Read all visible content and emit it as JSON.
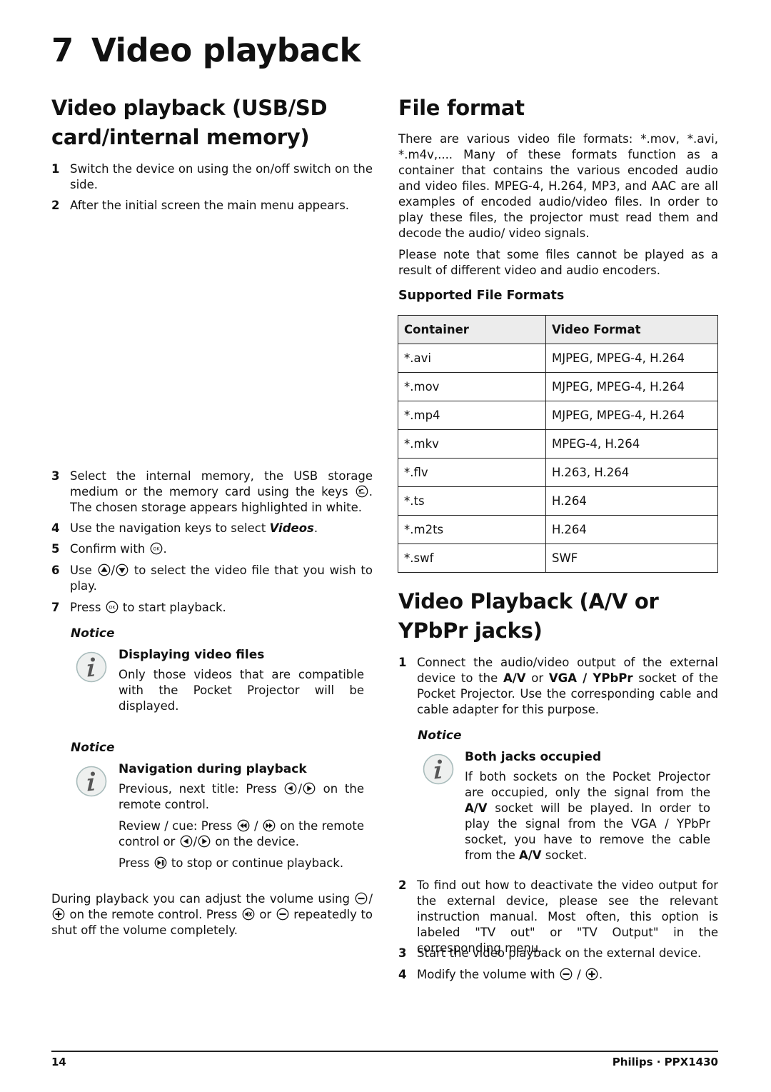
{
  "chapter": {
    "number": "7",
    "title": "Video playback"
  },
  "left": {
    "section_title_line1": "Video playback (USB/SD",
    "section_title_line2": "card/internal memory)",
    "steps": [
      {
        "n": "1",
        "text": "Switch the device on using the on/off switch on the side."
      },
      {
        "n": "2",
        "text": "After the initial screen the main menu appears."
      },
      {
        "n": "3",
        "text_a": "Select the internal memory, the USB storage medium or the memory card using the keys ",
        "text_b": ". The chosen storage appears highlighted in white.",
        "icon": "back-key-icon"
      },
      {
        "n": "4",
        "text_a": "Use the navigation keys to select ",
        "emph": "Videos",
        "text_b": "."
      },
      {
        "n": "5",
        "text_a": "Confirm with ",
        "text_b": ".",
        "icon": "ok-key-icon"
      },
      {
        "n": "6",
        "text_a": "Use ",
        "sep": "/",
        "text_b": " to select the video file that you wish to play.",
        "icons": [
          "up-key-icon",
          "down-key-icon"
        ]
      },
      {
        "n": "7",
        "text_a": "Press ",
        "text_b": " to start playback.",
        "icon": "ok-key-icon"
      }
    ],
    "notice1": {
      "label": "Notice",
      "title": "Displaying video files",
      "text": "Only those videos that are compatible with the Pocket Projector will be displayed."
    },
    "notice2": {
      "label": "Notice",
      "title": "Navigation during playback",
      "p1_a": "Previous, next title: Press ",
      "p1_sep": "/",
      "p1_b": " on the remote control.",
      "p2_a": "Review / cue: Press ",
      "p2_sep": " / ",
      "p2_b": " on the remote control or ",
      "p2_sep2": "/",
      "p2_c": " on the device.",
      "p3_a": "Press ",
      "p3_b": " to stop or continue playback."
    },
    "volume_para": {
      "a": "During playback you can adjust the volume using ",
      "sep": "/",
      "b": " on the remote control. Press ",
      "c": " or ",
      "d": " repeatedly to shut off the volume completely."
    }
  },
  "right": {
    "file_format_title": "File format",
    "p1": "There are various video file formats: *.mov, *.avi, *.m4v,.... Many of these formats function as a container that contains the various encoded audio and video files. MPEG-4, H.264, MP3, and AAC are all examples of encoded audio/video files. In order to play these files, the projector must read them and decode the audio/ video signals.",
    "p2": "Please note that some files cannot be played as a result of different video and audio encoders.",
    "supported_title": "Supported File Formats",
    "table": {
      "headers": [
        "Container",
        "Video Format"
      ],
      "rows": [
        [
          "*.avi",
          "MJPEG, MPEG-4, H.264"
        ],
        [
          "*.mov",
          "MJPEG, MPEG-4, H.264"
        ],
        [
          "*.mp4",
          "MJPEG, MPEG-4, H.264"
        ],
        [
          "*.mkv",
          "MPEG-4, H.264"
        ],
        [
          "*.flv",
          "H.263, H.264"
        ],
        [
          "*.ts",
          "H.264"
        ],
        [
          "*.m2ts",
          "H.264"
        ],
        [
          "*.swf",
          "SWF"
        ]
      ]
    },
    "av_title_line1": "Video Playback (A/V or",
    "av_title_line2": "YPbPr jacks)",
    "step1": {
      "n": "1",
      "a": "Connect the audio/video output of the external device to the ",
      "b1": "A/V",
      "c": " or ",
      "b2": "VGA / YPbPr",
      "d": "  socket of the Pocket Projector. Use the corresponding cable and cable adapter for this purpose."
    },
    "notice": {
      "label": "Notice",
      "title": "Both jacks occupied",
      "a": "If both sockets on the Pocket Projector are occupied, only the signal from the ",
      "b1": "A/V",
      "c": " socket will be played. In order to play the signal from the VGA / YPbPr socket, you have to remove the cable from the ",
      "b2": "A/V",
      "d": " socket."
    },
    "step2": {
      "n": "2",
      "text": "To find out how to deactivate the video output for the external device, please see the relevant instruction manual. Most often, this option is labeled \"TV out\" or \"TV Output\" in the corresponding menu."
    },
    "step3": {
      "n": "3",
      "text": "Start the video playback on the external device."
    },
    "step4": {
      "n": "4",
      "a": "Modify the volume with ",
      "sep": " / ",
      "b": "."
    }
  },
  "footer": {
    "page": "14",
    "brand": "Philips · PPX1430"
  }
}
